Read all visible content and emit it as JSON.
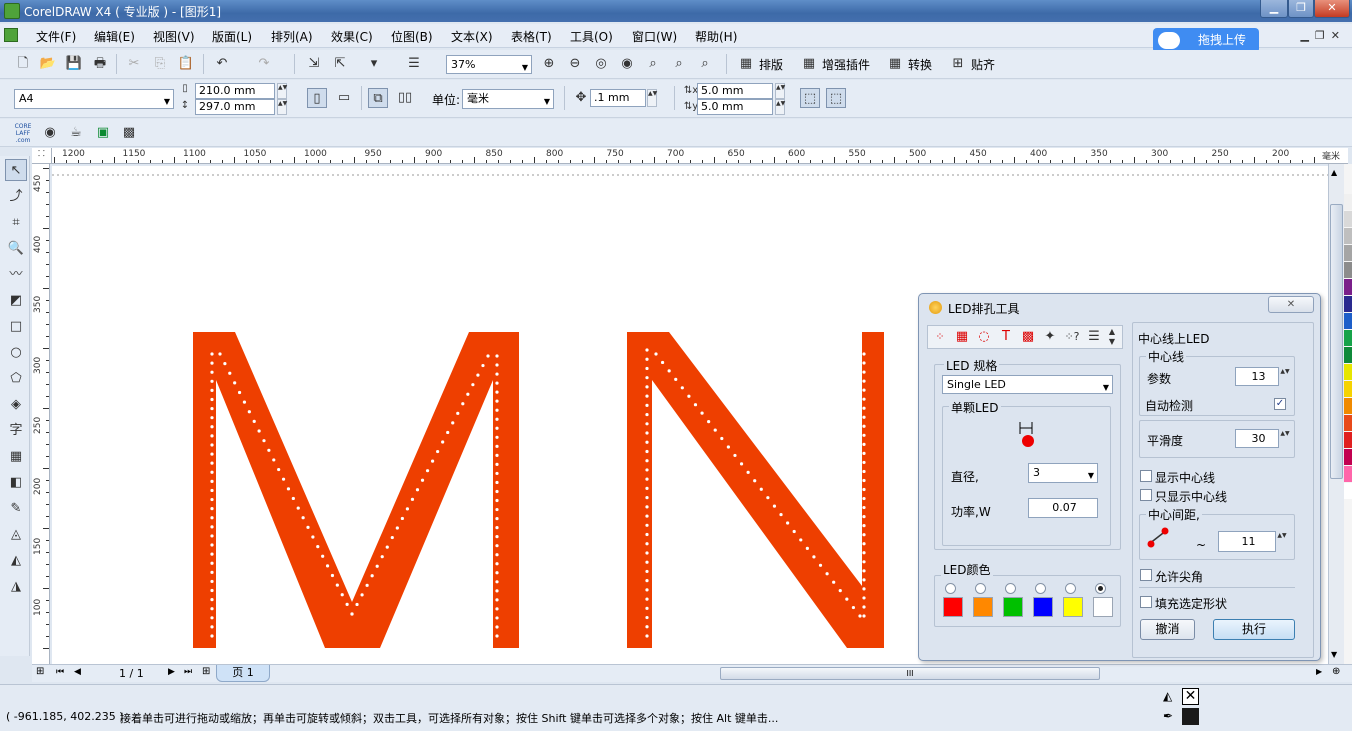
{
  "window": {
    "title": "CorelDRAW X4 ( 专业版 ) - [图形1]",
    "min": "▁",
    "max": "❐",
    "close": "✕"
  },
  "menu": [
    "文件(F)",
    "编辑(E)",
    "视图(V)",
    "版面(L)",
    "排列(A)",
    "效果(C)",
    "位图(B)",
    "文本(X)",
    "表格(T)",
    "工具(O)",
    "窗口(W)",
    "帮助(H)"
  ],
  "cloud_button": "拖拽上传",
  "toolbar": {
    "zoom": "37%",
    "paiban": "排版",
    "plugin": "增强插件",
    "convert": "转换",
    "snap": "贴齐"
  },
  "property": {
    "page_size": "A4",
    "width": "210.0 mm",
    "height": "297.0 mm",
    "unit_label": "单位:",
    "unit": "毫米",
    "nudge": ".1 mm",
    "dup_x": "5.0 mm",
    "dup_y": "5.0 mm"
  },
  "ruler": {
    "h_ticks": [
      "1200",
      "1150",
      "1100",
      "1050",
      "1000",
      "950",
      "900",
      "850",
      "800",
      "750",
      "700",
      "650",
      "600",
      "550",
      "500",
      "450",
      "400",
      "350",
      "300",
      "250",
      "200"
    ],
    "h_unit": "毫米",
    "v_ticks": [
      "450",
      "400",
      "350",
      "300",
      "250",
      "200",
      "150",
      "100"
    ]
  },
  "canvas": {
    "letters": [
      "M",
      "N"
    ],
    "letter_color": "#ee3f00",
    "dot_color": "#ffffff"
  },
  "pager": {
    "pages": "1 / 1",
    "tab": "页 1"
  },
  "status": {
    "coords": "( -961.185, 402.235 )",
    "hint": "接着单击可进行拖动或缩放；再单击可旋转或倾斜；双击工具，可选择所有对象；按住 Shift 键单击可选择多个对象；按住 Alt 键单击..."
  },
  "dialog": {
    "title": "LED排孔工具",
    "close": "✕",
    "led_spec": {
      "title": "LED 规格",
      "type": "Single LED",
      "single_title": "单颗LED",
      "diameter_label": "直径,",
      "diameter": "3",
      "power_label": "功率,W",
      "power": "0.07"
    },
    "led_color": {
      "title": "LED颜色",
      "colors": [
        "#ff0000",
        "#ff8800",
        "#00c000",
        "#0000ff",
        "#ffff00",
        "#ffffff"
      ],
      "selected": 5
    },
    "center": {
      "title": "中心线上LED",
      "sub": "中心线",
      "param_label": "参数",
      "param": "13",
      "auto_label": "自动检测",
      "auto": true,
      "smooth_label": "平滑度",
      "smooth": "30",
      "show_center": "显示中心线",
      "only_center": "只显示中心线",
      "spacing_title": "中心间距,",
      "spacing_tilde": "~",
      "spacing": "11",
      "allow_corner": "允许尖角",
      "fill_shape": "填充选定形状"
    },
    "cancel": "撤消",
    "execute": "执行"
  },
  "palette": [
    "#f0f0f0",
    "#d9d9d9",
    "#bfbfbf",
    "#a5a5a5",
    "#8c8c8c",
    "#7a1f8a",
    "#2a2a8f",
    "#1d5fc9",
    "#16a34a",
    "#0f8a3a",
    "#e6e600",
    "#f6d300",
    "#f08a00",
    "#e84a1a",
    "#e02020",
    "#c20050",
    "#ff66aa",
    "#ffffff"
  ]
}
